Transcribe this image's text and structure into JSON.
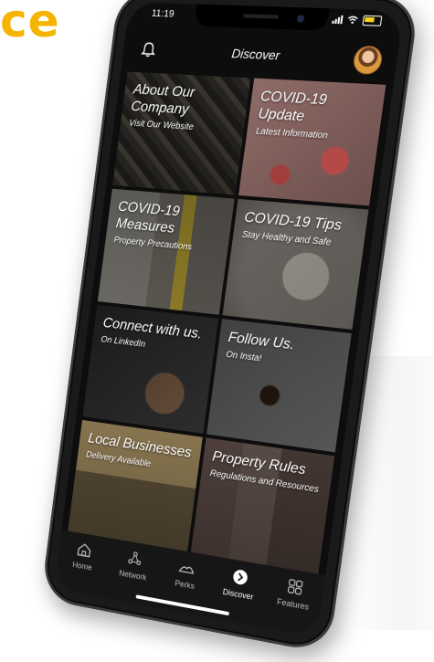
{
  "brand": {
    "text": "ce"
  },
  "status_bar": {
    "time": "11:19"
  },
  "app_bar": {
    "title": "Discover"
  },
  "tiles": [
    {
      "title": "About Our Company",
      "subtitle": "Visit Our Website"
    },
    {
      "title": "COVID-19 Update",
      "subtitle": "Latest Information"
    },
    {
      "title": "COVID-19 Measures",
      "subtitle": "Property Precautions"
    },
    {
      "title": "COVID-19 Tips",
      "subtitle": "Stay Healthy and Safe"
    },
    {
      "title": "Connect with us.",
      "subtitle": "On LinkedIn"
    },
    {
      "title": "Follow Us.",
      "subtitle": "On Insta!"
    },
    {
      "title": "Local Businesses",
      "subtitle": "Delivery Available"
    },
    {
      "title": "Property Rules",
      "subtitle": "Regulations and Resources"
    }
  ],
  "tab_bar": {
    "items": [
      {
        "label": "Home",
        "icon": "home-icon"
      },
      {
        "label": "Network",
        "icon": "network-icon"
      },
      {
        "label": "Perks",
        "icon": "perks-icon"
      },
      {
        "label": "Discover",
        "icon": "discover-icon",
        "active": true
      },
      {
        "label": "Features",
        "icon": "features-icon"
      }
    ]
  },
  "colors": {
    "brand": "#f5b400",
    "tabbar_bg": "#161616",
    "screen_bg": "#0d0d0d"
  }
}
